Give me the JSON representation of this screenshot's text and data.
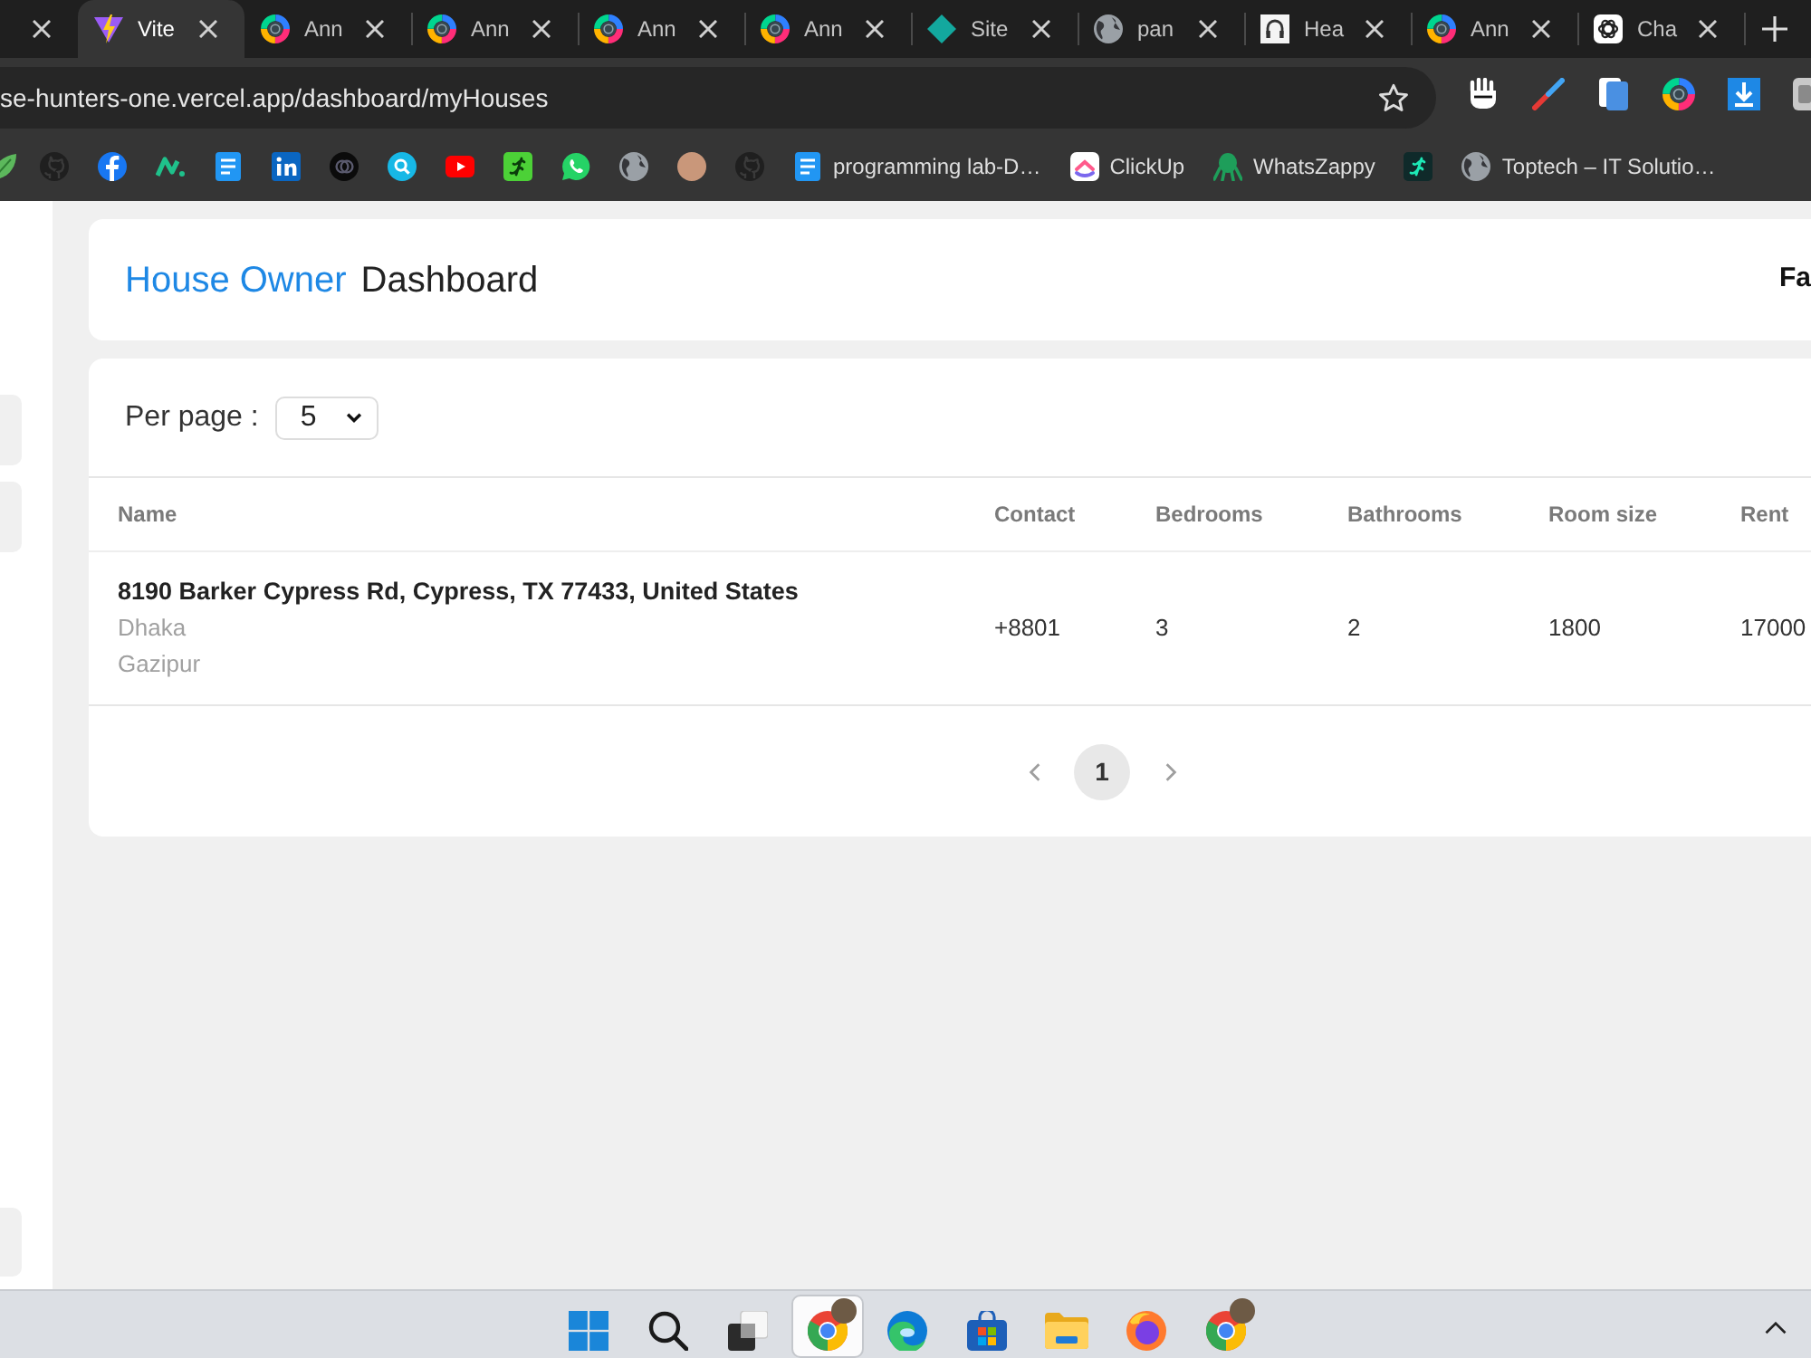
{
  "browser": {
    "tabs": [
      {
        "selected": false
      },
      {
        "title": "Vite",
        "selected": true
      },
      {
        "title": "Ann",
        "selected": false
      },
      {
        "title": "Ann",
        "selected": false
      },
      {
        "title": "Ann",
        "selected": false
      },
      {
        "title": "Ann",
        "selected": false
      },
      {
        "title": "Site",
        "selected": false
      },
      {
        "title": "pan",
        "selected": false
      },
      {
        "title": "Hea",
        "selected": false
      },
      {
        "title": "Ann",
        "selected": false
      },
      {
        "title": "Cha",
        "selected": false
      }
    ],
    "url": "se-hunters-one.vercel.app/dashboard/myHouses",
    "bookmarks": [
      "programming lab-D…",
      "ClickUp",
      "WhatsZappy",
      "Toptech – IT Solutio…"
    ]
  },
  "dashboard": {
    "title_accent": "House Owner",
    "title": "Dashboard",
    "user_name": "Fa",
    "per_page": {
      "label": "Per page :",
      "value": "5"
    },
    "table": {
      "columns": [
        "Name",
        "Contact",
        "Bedrooms",
        "Bathrooms",
        "Room size",
        "Rent"
      ],
      "rows": [
        {
          "name": "8190 Barker Cypress Rd, Cypress, TX 77433, United States",
          "subtitle_lines": [
            "Dhaka",
            "Gazipur"
          ],
          "contact": "+8801",
          "bedrooms": "3",
          "bathrooms": "2",
          "room_size": "1800",
          "rent": "17000"
        }
      ]
    },
    "pagination": {
      "pages": [
        {
          "label": "1",
          "selected": true
        }
      ]
    }
  },
  "taskbar": {
    "apps": [
      {
        "selected": false
      },
      {
        "selected": false
      },
      {
        "selected": false
      },
      {
        "selected": true
      },
      {
        "selected": false
      },
      {
        "selected": false
      },
      {
        "selected": false
      },
      {
        "selected": false
      },
      {
        "selected": false
      }
    ]
  }
}
